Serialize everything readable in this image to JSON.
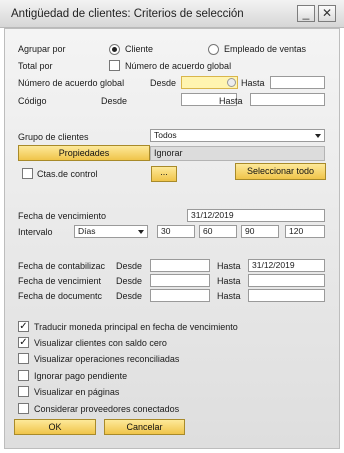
{
  "window": {
    "title": "Antigüedad de clientes: Criterios de selección",
    "minimize_label": "_",
    "close_label": "✕"
  },
  "agrupar": {
    "label": "Agrupar por",
    "option_cliente": "Cliente",
    "option_empleado": "Empleado de ventas",
    "selected": "Cliente"
  },
  "total_por": {
    "label": "Total por",
    "checkbox_label": "Número de acuerdo global",
    "checked": false
  },
  "numero_acuerdo": {
    "label": "Número de acuerdo global",
    "desde_label": "Desde",
    "hasta_label": "Hasta",
    "desde_value": "",
    "hasta_value": ""
  },
  "codigo": {
    "label": "Código",
    "desde_label": "Desde",
    "hasta_label": "Hasta",
    "desde_value": "",
    "hasta_value": ""
  },
  "grupo": {
    "label": "Grupo de clientes",
    "value": "Todos",
    "propiedades_button": "Propiedades",
    "propiedades_value": "Ignorar",
    "ctas_label": "Ctas.de control",
    "ctas_checked": false,
    "dots_button": "...",
    "seleccionar_button": "Seleccionar todo"
  },
  "vencimiento": {
    "fecha_label": "Fecha de vencimiento",
    "fecha_value": "31/12/2019",
    "intervalo_label": "Intervalo",
    "intervalo_value": "Días",
    "intervals": [
      "30",
      "60",
      "90",
      "120"
    ]
  },
  "date_ranges": [
    {
      "label": "Fecha de contabilizac",
      "desde_label": "Desde",
      "hasta_label": "Hasta",
      "desde_value": "",
      "hasta_value": "31/12/2019"
    },
    {
      "label": "Fecha de vencimient",
      "desde_label": "Desde",
      "hasta_label": "Hasta",
      "desde_value": "",
      "hasta_value": ""
    },
    {
      "label": "Fecha de documentc",
      "desde_label": "Desde",
      "hasta_label": "Hasta",
      "desde_value": "",
      "hasta_value": ""
    }
  ],
  "options": [
    {
      "label": "Traducir moneda principal en fecha de vencimiento",
      "checked": true
    },
    {
      "label": "Visualizar clientes con saldo cero",
      "checked": true
    },
    {
      "label": "Visualizar operaciones reconciliadas",
      "checked": false
    },
    {
      "label": "Ignorar pago pendiente",
      "checked": false
    },
    {
      "label": "Visualizar en páginas",
      "checked": false
    },
    {
      "label": "Considerar proveedores conectados",
      "checked": false
    }
  ],
  "footer": {
    "ok_button": "OK",
    "cancel_button": "Cancelar"
  },
  "colors": {
    "button_gold": "#f0c44a",
    "focus_field": "#fff4b0"
  }
}
